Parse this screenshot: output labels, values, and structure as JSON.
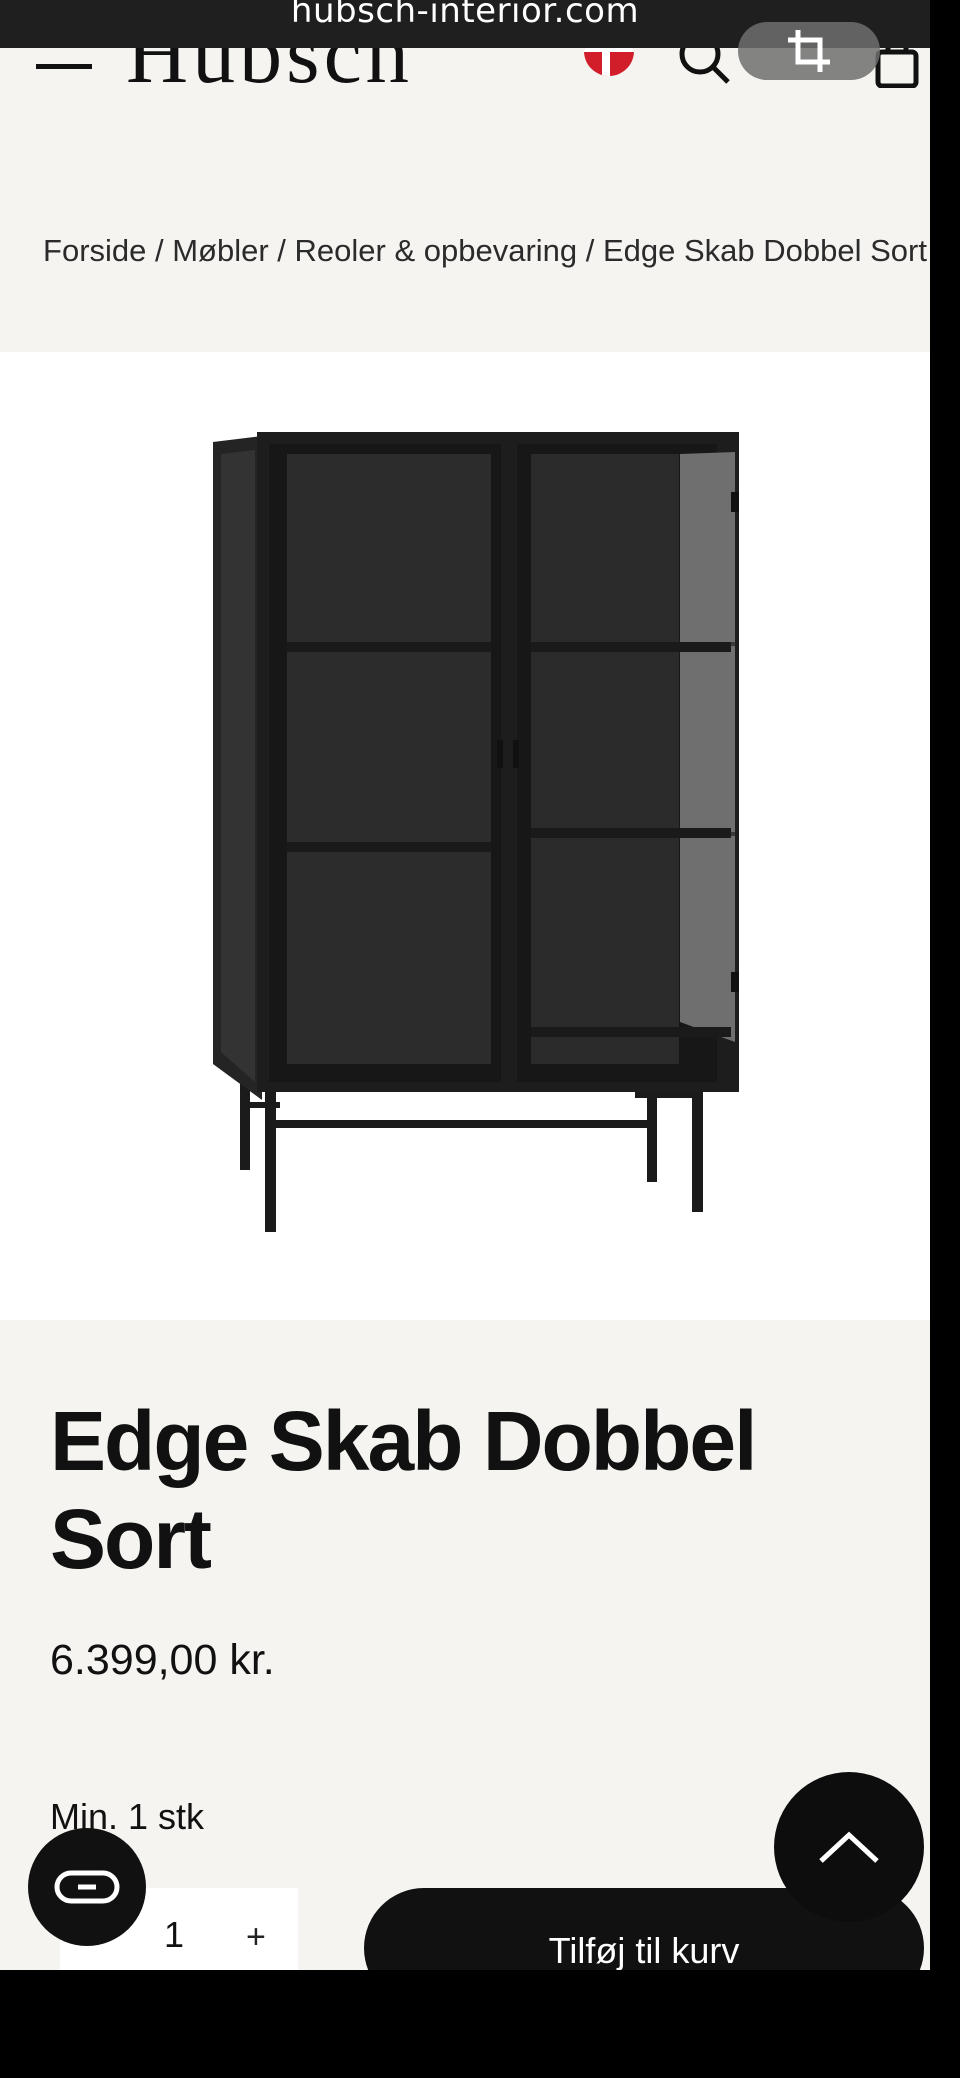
{
  "browser": {
    "url": "hubsch-interior.com"
  },
  "header": {
    "logo": "Hübsch"
  },
  "breadcrumb": {
    "text": "Forside / Møbler / Reoler & opbevaring / Edge Skab Dobbel Sort"
  },
  "product": {
    "title": "Edge Skab Dobbel Sort",
    "price": "6.399,00 kr.",
    "min_qty": "Min. 1 stk",
    "qty_minus": "–",
    "qty_value": "1",
    "qty_plus": "+",
    "add_to_cart": "Tilføj til kurv"
  },
  "icons": {
    "menu": "menu-icon",
    "flag": "danish-flag-icon",
    "search": "search-icon",
    "bag": "shopping-bag-icon",
    "crop": "crop-icon",
    "scroll_top": "chevron-up-icon",
    "chat": "chat-icon"
  },
  "colors": {
    "background": "#f5f4f0",
    "accent": "#111111",
    "flag_red": "#d21e2b"
  }
}
